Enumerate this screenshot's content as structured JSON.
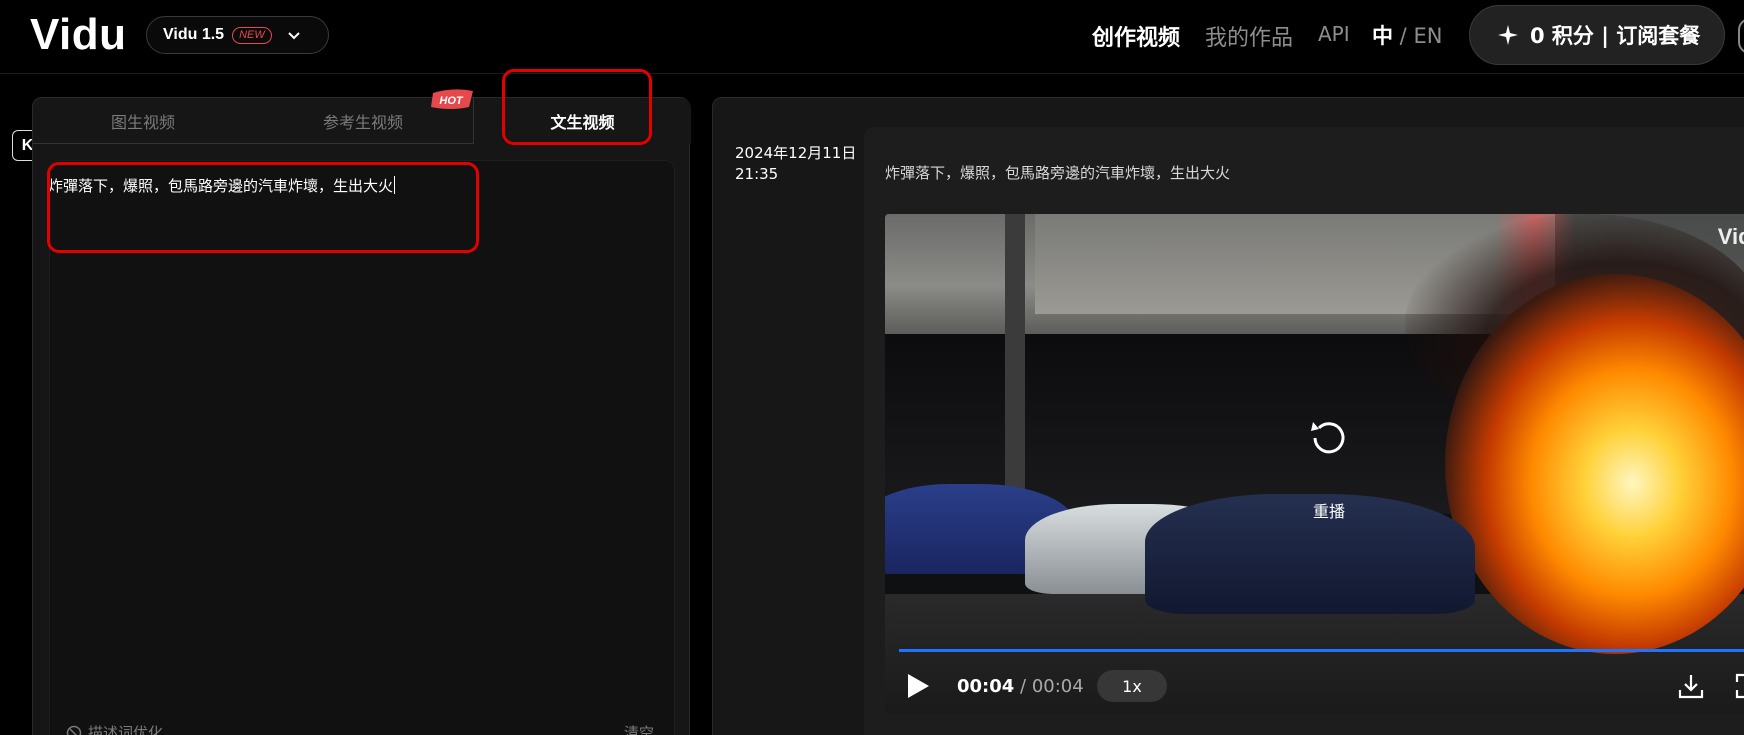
{
  "header": {
    "logo": "Vidu",
    "version": {
      "label": "Vidu 1.5",
      "badge": "NEW"
    },
    "nav": {
      "create": "创作视频",
      "works": "我的作品",
      "api": "API"
    },
    "lang": {
      "zh": "中",
      "sep": " / ",
      "en": "EN"
    },
    "credits": "0 积分 | 订阅套餐"
  },
  "left": {
    "tabs": [
      "图生视频",
      "参考生视频",
      "文生视频"
    ],
    "active_tab": "文生视频",
    "hot_badge": "HOT",
    "prompt": "炸彈落下，爆照，包馬路旁邊的汽車炸壞，生出大火",
    "optimize_label": "描述词优化",
    "clear_label": "清空",
    "side_logo": "K"
  },
  "right": {
    "timestamp_date": "2024年12月11日",
    "timestamp_time": "21:35",
    "prompt": "炸彈落下，爆照，包馬路旁邊的汽車炸壞，生出大火",
    "video": {
      "watermark": "Vidu",
      "replay_label": "重播",
      "current_time": "00:04",
      "time_sep": " / ",
      "duration": "00:04",
      "speed": "1x",
      "progress": 1.0
    }
  },
  "colors": {
    "accent_blue": "#1f73ff",
    "annotation_red": "#e50000",
    "new_badge": "#e5484d"
  }
}
